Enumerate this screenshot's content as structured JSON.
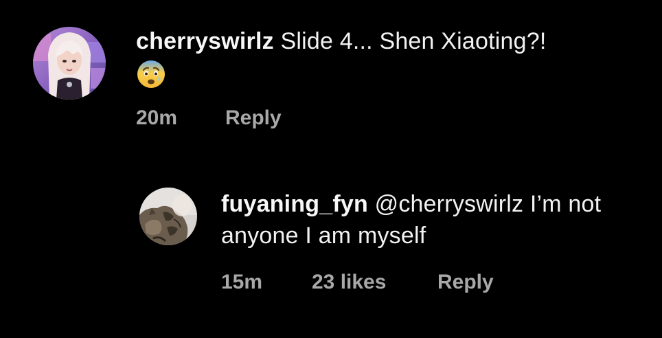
{
  "comments": [
    {
      "username": "cherryswirlz",
      "text": "Slide 4... Shen Xiaoting?!",
      "emoji_icon": "anxious-face-emoji",
      "time": "20m",
      "reply_label": "Reply",
      "avatar_icon": "profile-avatar-pink-hair"
    },
    {
      "username": "fuyaning_fyn",
      "mention": "@cherryswirlz",
      "text": "I’m not anyone I am myself",
      "time": "15m",
      "likes": "23 likes",
      "reply_label": "Reply",
      "avatar_icon": "profile-avatar-cat"
    }
  ],
  "colors": {
    "background": "#000000",
    "text": "#f2f2f2",
    "meta": "#a8a8a8"
  }
}
